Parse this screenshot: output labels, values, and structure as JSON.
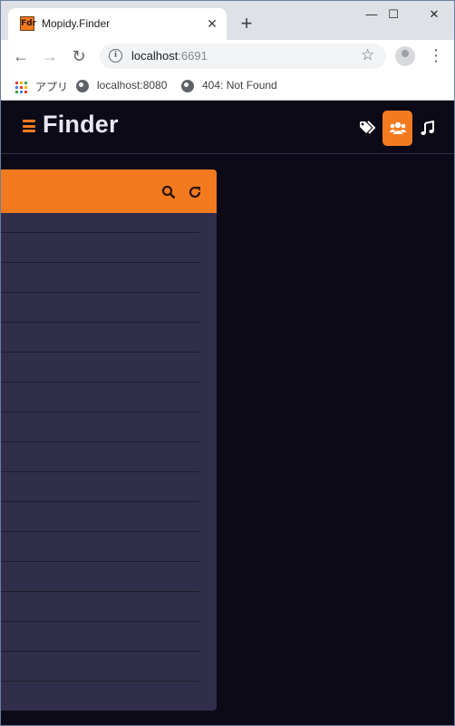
{
  "browser": {
    "tab_title": "Mopidy.Finder",
    "tab_favicon_text": "Fdr",
    "tab_close": "✕",
    "new_tab": "+",
    "window_controls": {
      "minimize": "—",
      "maximize": "☐",
      "close": "✕"
    },
    "nav": {
      "back": "←",
      "forward": "→",
      "reload": "↻"
    },
    "address": {
      "host": "localhost",
      "port": ":6691"
    },
    "bookmarks": [
      {
        "label": "アプリ",
        "icon": "apps-grid-icon"
      },
      {
        "label": "localhost:8080",
        "icon": "globe-icon"
      },
      {
        "label": "404: Not Found",
        "icon": "globe-icon"
      }
    ]
  },
  "app": {
    "title": "Finder",
    "header_icons": [
      {
        "name": "tags-icon",
        "active": false
      },
      {
        "name": "users-icon",
        "active": true
      },
      {
        "name": "music-icon",
        "active": false
      }
    ],
    "panel": {
      "actions": [
        "search-icon",
        "refresh-icon"
      ],
      "row_count": 16
    },
    "colors": {
      "accent": "#f47a20",
      "background": "#0b0a16",
      "panel": "#302e4a"
    }
  }
}
